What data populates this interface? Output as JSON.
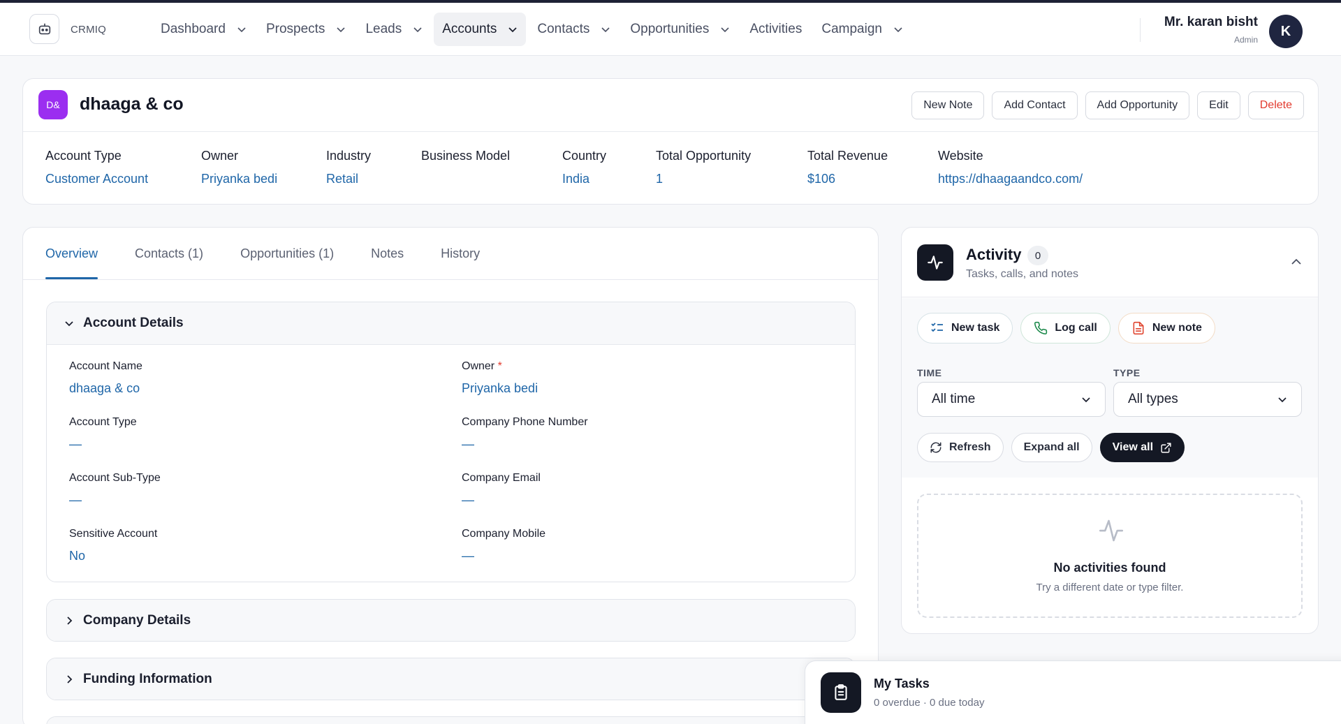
{
  "app": {
    "name": "CRMIQ"
  },
  "nav": {
    "items": [
      {
        "label": "Dashboard",
        "dropdown": true,
        "active": false
      },
      {
        "label": "Prospects",
        "dropdown": true,
        "active": false
      },
      {
        "label": "Leads",
        "dropdown": true,
        "active": false
      },
      {
        "label": "Accounts",
        "dropdown": true,
        "active": true
      },
      {
        "label": "Contacts",
        "dropdown": true,
        "active": false
      },
      {
        "label": "Opportunities",
        "dropdown": true,
        "active": false
      },
      {
        "label": "Activities",
        "dropdown": false,
        "active": false
      },
      {
        "label": "Campaign",
        "dropdown": true,
        "active": false
      }
    ]
  },
  "user": {
    "name": "Mr. karan bisht",
    "role": "Admin",
    "initial": "K"
  },
  "account": {
    "badge": "D&",
    "title": "dhaaga & co",
    "actions": {
      "new_note": "New Note",
      "add_contact": "Add Contact",
      "add_opportunity": "Add Opportunity",
      "edit": "Edit",
      "delete": "Delete"
    },
    "meta": [
      {
        "label": "Account Type",
        "value": "Customer Account"
      },
      {
        "label": "Owner",
        "value": "Priyanka bedi"
      },
      {
        "label": "Industry",
        "value": "Retail"
      },
      {
        "label": "Business Model",
        "value": ""
      },
      {
        "label": "Country",
        "value": "India"
      },
      {
        "label": "Total Opportunity",
        "value": "1"
      },
      {
        "label": "Total Revenue",
        "value": "$106"
      },
      {
        "label": "Website",
        "value": "https://dhaagaandco.com/"
      }
    ]
  },
  "tabs": [
    {
      "label": "Overview",
      "active": true
    },
    {
      "label": "Contacts (1)",
      "active": false
    },
    {
      "label": "Opportunities (1)",
      "active": false
    },
    {
      "label": "Notes",
      "active": false
    },
    {
      "label": "History",
      "active": false
    }
  ],
  "sections": {
    "account_details": {
      "title": "Account Details",
      "fields": {
        "account_name": {
          "label": "Account Name",
          "value": "dhaaga & co"
        },
        "owner": {
          "label": "Owner",
          "required_mark": "*",
          "value": "Priyanka bedi"
        },
        "account_type": {
          "label": "Account Type",
          "value": "—"
        },
        "company_phone": {
          "label": "Company Phone Number",
          "value": "—"
        },
        "account_sub_type": {
          "label": "Account Sub-Type",
          "value": "—"
        },
        "company_email": {
          "label": "Company Email",
          "value": "—"
        },
        "sensitive_account": {
          "label": "Sensitive Account",
          "value": "No"
        },
        "company_mobile": {
          "label": "Company Mobile",
          "value": "—"
        }
      }
    },
    "company_details": {
      "title": "Company Details"
    },
    "funding_information": {
      "title": "Funding Information"
    }
  },
  "activity": {
    "title": "Activity",
    "count": "0",
    "subtitle": "Tasks, calls, and notes",
    "quick_actions": {
      "new_task": "New task",
      "log_call": "Log call",
      "new_note": "New note"
    },
    "filters": {
      "time_label": "TIME",
      "time_value": "All time",
      "type_label": "TYPE",
      "type_value": "All types"
    },
    "buttons": {
      "refresh": "Refresh",
      "expand_all": "Expand all",
      "view_all": "View all"
    },
    "empty": {
      "title": "No activities found",
      "subtitle": "Try a different date or type filter."
    }
  },
  "tasks_widget": {
    "title": "My Tasks",
    "subtitle": "0 overdue · 0 due today"
  },
  "colors": {
    "accent": "#1f66a8",
    "danger": "#e23a2e",
    "badge": "#9b2ef0",
    "dark": "#141824"
  }
}
